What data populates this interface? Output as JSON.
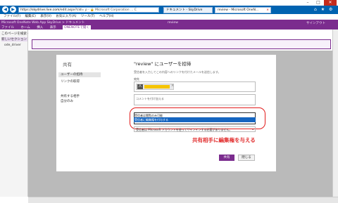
{
  "window": {
    "min": "–",
    "max": "□",
    "close": "✕"
  },
  "browser": {
    "back_icon": "back-arrow-icon",
    "forward_icon": "forward-arrow-icon",
    "url_prefix": "https://",
    "url_host": "skydrive.live.com",
    "url_rest": "/edit.aspx?cid=",
    "url_controls": "ρ ‑ 🔒 Microsoft Corporation ... C",
    "tabs": [
      {
        "label": "ドキュメント - SkyDrive"
      },
      {
        "label": "review - Microsoft OneN..."
      }
    ],
    "right_icons": "⌂ ★ ⚙",
    "menu": [
      "ファイル(F)",
      "編集(E)",
      "表示(V)",
      "お気に入り(A)",
      "ツール(T)",
      "ヘルプ(H)"
    ]
  },
  "app": {
    "breadcrumb": "Microsoft OneNote Web App   SkyDrive > ドキュメント",
    "center_title": "review",
    "signin": "サインアウト",
    "ribbon": [
      "ファイル",
      "ホーム",
      "挿入",
      "表示"
    ],
    "onenote_tag": "ONENOTEで開く"
  },
  "left_pane": {
    "items": [
      "このページを検索 (Ctrl+F)",
      "新しいセクション 1",
      "ode_driver"
    ]
  },
  "dialog": {
    "left_title": "共有",
    "side": [
      "ユーザーの招待",
      "リンクの取得",
      "共有する相手",
      "自分のみ"
    ],
    "title": "\"review\" にユーザーを招待",
    "description": "受信者を入力してこの内容へのリンクを付けたメールを送信します。",
    "to_label": "宛先",
    "chip_icon": "人",
    "chip_close": "×",
    "comment_placeholder": "コメントを付け加える",
    "dropdown_options": [
      "受信者は閲覧のみ可能",
      "受信者に編集権を付与する"
    ],
    "permission_select": "受信者は Microsoft アカウントを使ってサインインする必要がありません。",
    "share_button": "共有",
    "close_button": "閉じる"
  },
  "annotation": "共有相手に編集権を与える",
  "colors": {
    "onenote_purple": "#7b2c8e",
    "ie_blue": "#0063b1",
    "annotation_red": "#e23030"
  }
}
